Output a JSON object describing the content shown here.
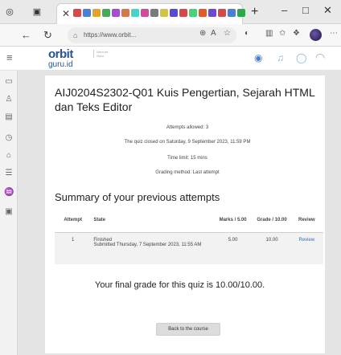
{
  "browser": {
    "window_controls": {
      "minimize": "–",
      "maximize": "□",
      "close": "✕"
    },
    "tab_close": "✕",
    "new_tab": "+",
    "url": "https://www.orbit...",
    "icon_colors": [
      "#d24a4a",
      "#4a7fd2",
      "#e0a42a",
      "#4aa85a",
      "#a84ad2",
      "#d2784a",
      "#4ad2c6",
      "#d24a9a",
      "#7a7a7a",
      "#d2c44a",
      "#5a4ad2",
      "#d24a4a",
      "#4ad27a",
      "#e05a2a",
      "#6a4ad2",
      "#d24a4a",
      "#4a7fd2",
      "#2aa84a"
    ]
  },
  "site": {
    "logo_top": "orbit",
    "logo_bottom": "guru.id",
    "tagline": "Guru Ini Guru"
  },
  "quiz": {
    "title": "AIJ0204S2302-Q01 Kuis Pengertian, Sejarah HTML dan Teks Editor",
    "attempts_allowed": "Attempts allowed: 3",
    "closed": "The quiz closed on Saturday, 9 September 2023, 11:59 PM",
    "time_limit": "Time limit: 15 mins",
    "grading": "Grading method: Last attempt"
  },
  "summary": {
    "heading": "Summary of your previous attempts",
    "columns": [
      "Attempt",
      "State",
      "Marks / 5.00",
      "Grade / 10.00",
      "Review"
    ],
    "rows": [
      {
        "attempt": "1",
        "state": "Finished",
        "submitted": "Submitted Thursday, 7 September 2023, 11:55 AM",
        "marks": "5.00",
        "grade": "10.00",
        "review": "Review"
      }
    ]
  },
  "final_grade": "Your final grade for this quiz is 10.00/10.00.",
  "back_button": "Back to the course",
  "colors": {
    "accent": "#27548a",
    "link": "#3a6db8"
  }
}
